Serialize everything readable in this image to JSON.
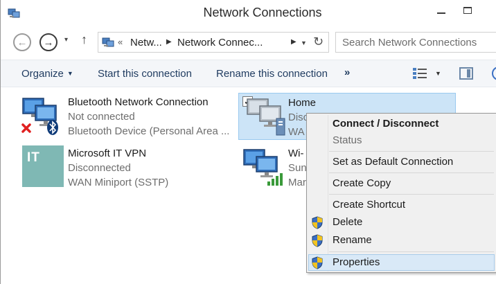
{
  "window": {
    "title": "Network Connections"
  },
  "navigation": {
    "back_label": "←",
    "forward_label": "→",
    "recent_label": "▾",
    "up_label": "↑",
    "address_overflow": "«",
    "breadcrumb_1": "Netw...",
    "breadcrumb_2": "Network Connec...",
    "refresh_label": "↻",
    "search_placeholder": "Search Network Connections"
  },
  "command_bar": {
    "organize": "Organize",
    "start_connection": "Start this connection",
    "rename_connection": "Rename this connection",
    "more": "»"
  },
  "connections": [
    {
      "name": "Bluetooth Network Connection",
      "status": "Not connected",
      "device": "Bluetooth Device (Personal Area ..."
    },
    {
      "name": "Microsoft IT VPN",
      "status": "Disconnected",
      "device": "WAN Miniport (SSTP)",
      "tile_text": "IT"
    },
    {
      "name": "Home",
      "status": "Disc",
      "device": "WA"
    },
    {
      "name": "Wi-",
      "status": "Sun",
      "device": "Mar"
    }
  ],
  "context_menu": {
    "connect_disconnect": "Connect / Disconnect",
    "status": "Status",
    "set_default": "Set as Default Connection",
    "create_copy": "Create Copy",
    "create_shortcut": "Create Shortcut",
    "delete": "Delete",
    "rename": "Rename",
    "properties": "Properties"
  },
  "colors": {
    "selection_bg": "#cce4f7",
    "selection_border": "#99c9ef",
    "command_text": "#1e3a5f",
    "vpn_tile": "#7fb8b4"
  }
}
